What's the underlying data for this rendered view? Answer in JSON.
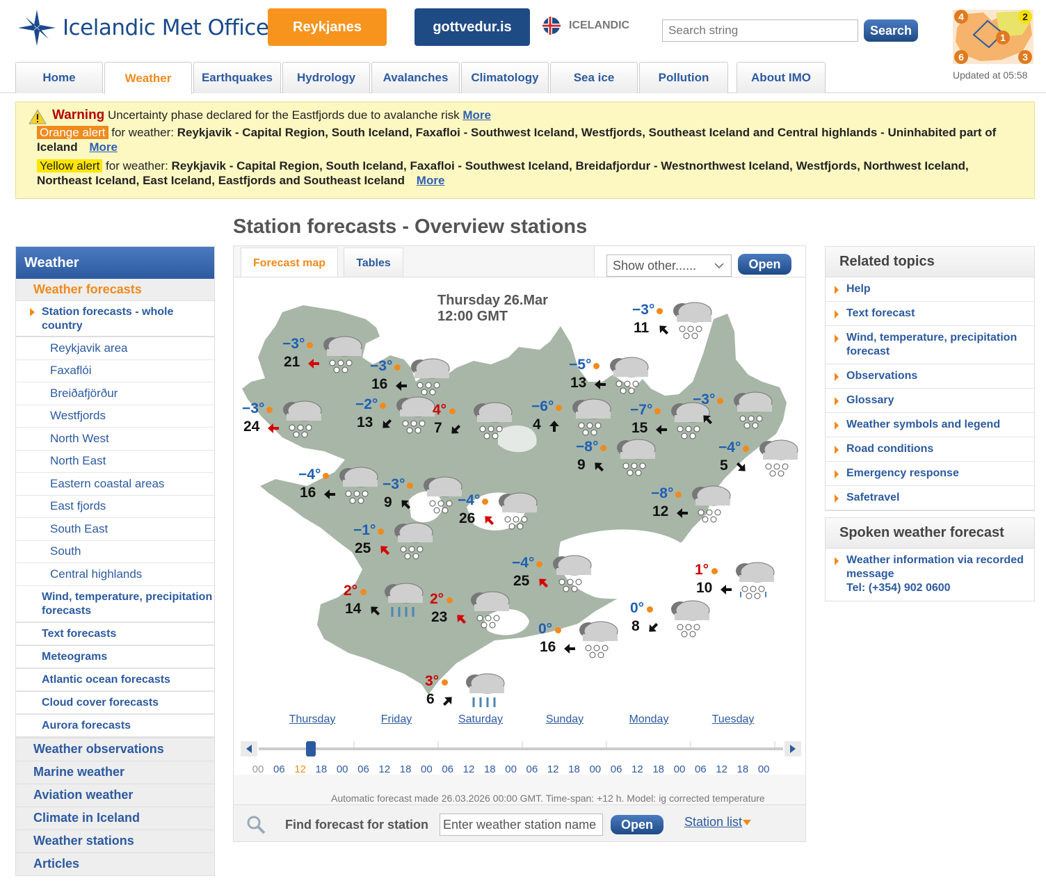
{
  "header": {
    "site_name": "Icelandic Met Office",
    "region_button": "Reykjanes",
    "vedur_button": "gottvedur.is",
    "language": "ICELANDIC",
    "search_placeholder": "Search string",
    "search_button": "Search",
    "updated": "Updated at 05:58",
    "minimap_labels": [
      "4",
      "2",
      "1",
      "6",
      "3"
    ]
  },
  "tabs": [
    "Home",
    "Weather",
    "Earthquakes",
    "Hydrology",
    "Avalanches",
    "Climatology",
    "Sea ice",
    "Pollution",
    "About IMO"
  ],
  "warning": {
    "title": "Warning",
    "text": "Uncertainty phase declared for the Eastfjords due to avalanche risk",
    "more": "More",
    "orange_tag": "Orange alert",
    "orange_pre": "for weather:",
    "orange_regions": "Reykjavik - Capital Region, South Iceland, Faxafloi - Southwest Iceland, Westfjords, Southeast Iceland and Central highlands - Uninhabited part of Iceland",
    "yellow_tag": "Yellow alert",
    "yellow_pre": "for weather:",
    "yellow_regions": "Reykjavik - Capital Region, South Iceland, Faxafloi - Southwest Iceland, Breidafjordur - Westnorthwest Iceland, Westfjords, Northwest Iceland, Northeast Iceland, East Iceland, Eastfjords and Southeast Iceland"
  },
  "page_title": "Station forecasts - Overview stations",
  "leftnav": {
    "head": "Weather",
    "section": "Weather forecasts",
    "current": "Station forecasts - whole country",
    "subs": [
      "Reykjavik area",
      "Faxaflói",
      "Breiðafjörður",
      "Westfjords",
      "North West",
      "North East",
      "Eastern coastal areas",
      "East fjords",
      "South East",
      "South",
      "Central highlands"
    ],
    "items": [
      "Wind, temperature, precipitation forecasts",
      "Text forecasts",
      "Meteograms",
      "Atlantic ocean forecasts",
      "Cloud cover forecasts",
      "Aurora forecasts"
    ],
    "bottom": [
      "Weather observations",
      "Marine weather",
      "Aviation weather",
      "Climate in Iceland",
      "Weather stations",
      "Articles"
    ]
  },
  "main": {
    "tab_map": "Forecast map",
    "tab_tables": "Tables",
    "show_other": "Show other......",
    "open": "Open",
    "date": "Thursday 26.Mar",
    "time": "12:00 GMT",
    "days": [
      "Thursday",
      "Friday",
      "Saturday",
      "Sunday",
      "Monday",
      "Tuesday"
    ],
    "hours": [
      "00",
      "06",
      "12",
      "18",
      "00",
      "06",
      "12",
      "18",
      "00",
      "06",
      "12",
      "18",
      "00",
      "06",
      "12",
      "18",
      "00",
      "06",
      "12",
      "18",
      "00",
      "06",
      "12",
      "18",
      "00"
    ],
    "footnote": "Automatic forecast made 26.03.2026 00:00 GMT. Time-span: +12 h. Model: ig corrected temperature",
    "find_label": "Find forecast for station",
    "find_placeholder": "Enter weather station name",
    "find_open": "Open",
    "station_list": "Station list"
  },
  "stations": [
    {
      "temp": "−3°",
      "wind": "11",
      "dir": "nw",
      "red": false,
      "sym": "snow"
    },
    {
      "temp": "−3°",
      "wind": "21",
      "dir": "w",
      "red": true,
      "sym": "snow"
    },
    {
      "temp": "−3°",
      "wind": "16",
      "dir": "w",
      "red": false,
      "sym": "snow"
    },
    {
      "temp": "−5°",
      "wind": "13",
      "dir": "w",
      "red": false,
      "sym": "snow"
    },
    {
      "temp": "−3°",
      "wind": "24",
      "dir": "w",
      "red": true,
      "sym": "snow"
    },
    {
      "temp": "−2°",
      "wind": "13",
      "dir": "sw",
      "red": false,
      "sym": "snow"
    },
    {
      "temp": "4°",
      "wind": "7",
      "dir": "sw",
      "red": false,
      "sym": "snow"
    },
    {
      "temp": "−6°",
      "wind": "4",
      "dir": "n",
      "red": false,
      "sym": "snow"
    },
    {
      "temp": "−7°",
      "wind": "15",
      "dir": "w",
      "red": false,
      "sym": "snow"
    },
    {
      "temp": "−3°",
      "wind": "",
      "dir": "nw",
      "red": false,
      "sym": "snow"
    },
    {
      "temp": "−8°",
      "wind": "9",
      "dir": "nw",
      "red": false,
      "sym": "snow"
    },
    {
      "temp": "−4°",
      "wind": "5",
      "dir": "se",
      "red": false,
      "sym": "snow"
    },
    {
      "temp": "−4°",
      "wind": "16",
      "dir": "w",
      "red": false,
      "sym": "snow"
    },
    {
      "temp": "−3°",
      "wind": "9",
      "dir": "nw",
      "red": false,
      "sym": "snow"
    },
    {
      "temp": "−4°",
      "wind": "26",
      "dir": "nw",
      "red": true,
      "sym": "snow"
    },
    {
      "temp": "−8°",
      "wind": "12",
      "dir": "w",
      "red": false,
      "sym": "snow"
    },
    {
      "temp": "−1°",
      "wind": "25",
      "dir": "nw",
      "red": true,
      "sym": "snow"
    },
    {
      "temp": "−4°",
      "wind": "25",
      "dir": "nw",
      "red": true,
      "sym": "snow"
    },
    {
      "temp": "1°",
      "wind": "10",
      "dir": "w",
      "red": false,
      "sym": "sleet"
    },
    {
      "temp": "2°",
      "wind": "14",
      "dir": "nw",
      "red": false,
      "sym": "rain"
    },
    {
      "temp": "2°",
      "wind": "23",
      "dir": "nw",
      "red": true,
      "sym": "snow"
    },
    {
      "temp": "0°",
      "wind": "8",
      "dir": "sw",
      "red": false,
      "sym": "snow"
    },
    {
      "temp": "0°",
      "wind": "16",
      "dir": "w",
      "red": false,
      "sym": "snow"
    },
    {
      "temp": "3°",
      "wind": "6",
      "dir": "ne",
      "red": false,
      "sym": "rain"
    }
  ],
  "related": {
    "head": "Related topics",
    "items": [
      "Help",
      "Text forecast",
      "Wind, temperature, precipitation forecast",
      "Observations",
      "Glossary",
      "Weather symbols and legend",
      "Road conditions",
      "Emergency response",
      "Safetravel"
    ]
  },
  "spoken": {
    "head": "Spoken weather forecast",
    "text": "Weather information via recorded message",
    "tel": "Tel: (+354) 902 0600"
  },
  "colors": {
    "accent": "#f08a1c",
    "brand": "#1f4b85",
    "link": "#2c5aa0",
    "land": "#a4b2a4"
  }
}
